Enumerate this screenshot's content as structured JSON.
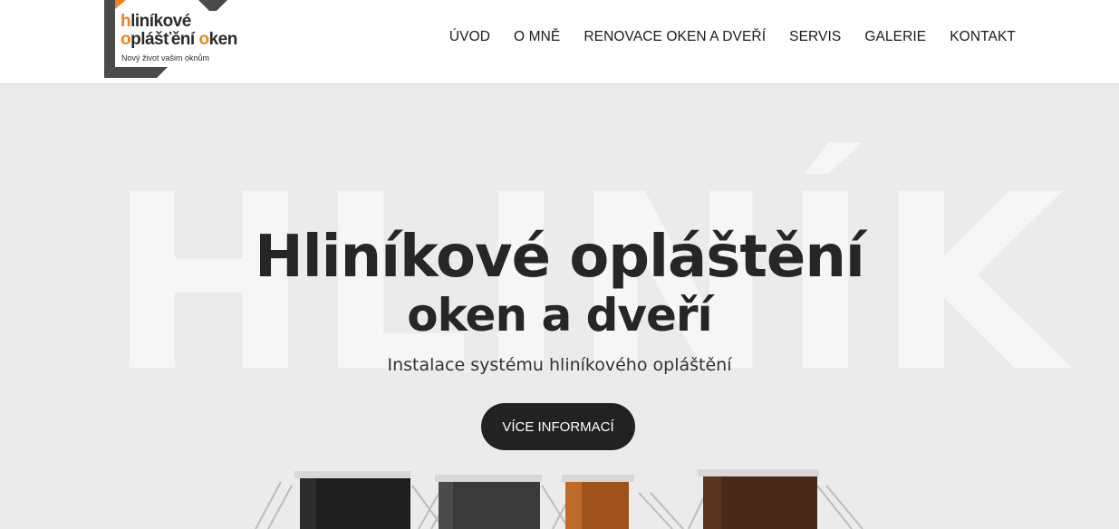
{
  "logo": {
    "line1_accent": "h",
    "line1_rest": "liníkové",
    "line2_accent1": "o",
    "line2_mid": "plášťění ",
    "line2_accent2": "o",
    "line2_rest": "ken",
    "tagline": "Nový život vašim oknům",
    "colors": {
      "accent": "#f0821e",
      "frame": "#4a4a4a"
    }
  },
  "nav": {
    "items": [
      {
        "label": "ÚVOD"
      },
      {
        "label": "O MNĚ"
      },
      {
        "label": "RENOVACE OKEN A DVEŘÍ"
      },
      {
        "label": "SERVIS"
      },
      {
        "label": "GALERIE"
      },
      {
        "label": "KONTAKT"
      }
    ]
  },
  "hero": {
    "watermark": "HLINÍK",
    "title_line1": "Hliníkové opláštění",
    "title_line2": "oken a dveří",
    "subtitle": "Instalace systému hliníkového opláštění",
    "cta_label": "VÍCE INFORMACÍ",
    "profile_samples": [
      {
        "name": "black",
        "color": "#1e1e1e"
      },
      {
        "name": "anthracite",
        "color": "#3a3a3a"
      },
      {
        "name": "oak",
        "color": "#a0521c"
      },
      {
        "name": "walnut",
        "color": "#4a2a18"
      }
    ]
  }
}
